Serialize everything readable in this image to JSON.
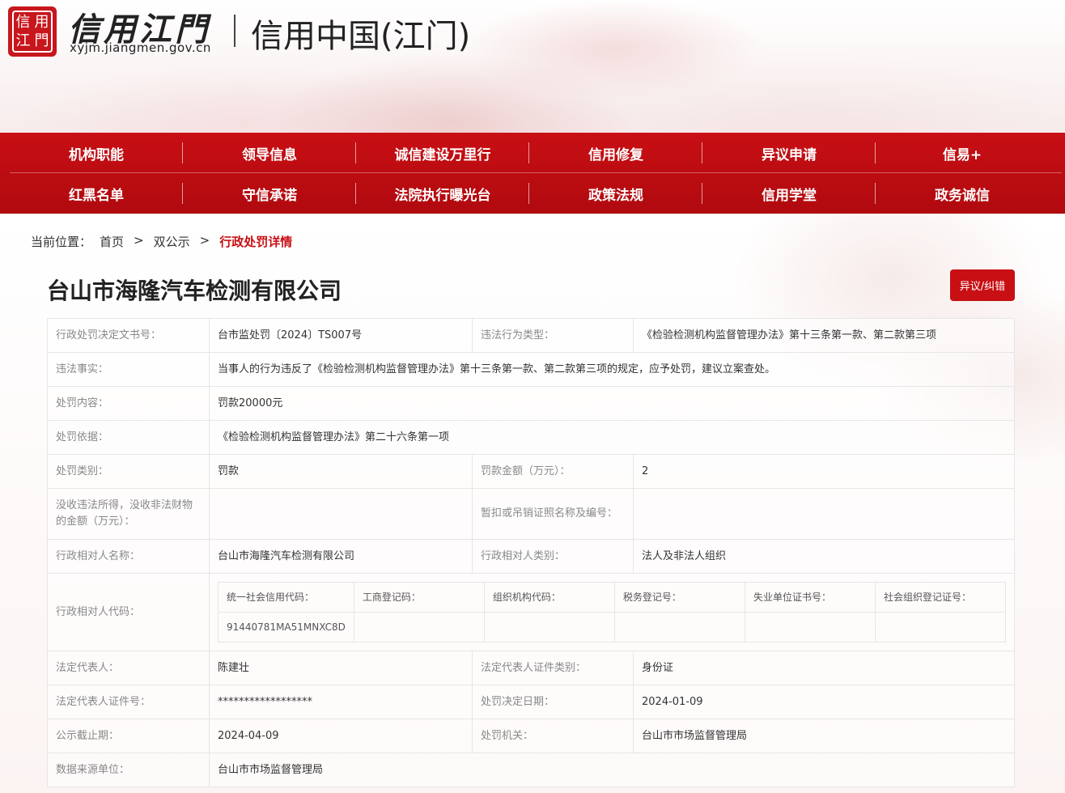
{
  "header": {
    "seal_text": "信用江門",
    "logo_title": "信用江門",
    "logo_domain": "xyjm.jiangmen.gov.cn",
    "site_name": "信用中国(江门)"
  },
  "nav": {
    "row1": [
      "机构职能",
      "领导信息",
      "诚信建设万里行",
      "信用修复",
      "异议申请",
      "信易+"
    ],
    "row2": [
      "红黑名单",
      "守信承诺",
      "法院执行曝光台",
      "政策法规",
      "信用学堂",
      "政务诚信"
    ]
  },
  "breadcrumb": {
    "label": "当前位置：",
    "home": "首页",
    "sep": ">",
    "section": "双公示",
    "current": "行政处罚详情"
  },
  "page": {
    "company_title": "台山市海隆汽车检测有限公司",
    "objection_button": "异议/纠错"
  },
  "details": {
    "decision_no_label": "行政处罚决定文书号：",
    "decision_no": "台市监处罚〔2024〕TS007号",
    "violation_type_label": "违法行为类型：",
    "violation_type": "《检验检测机构监督管理办法》第十三条第一款、第二款第三项",
    "facts_label": "违法事实：",
    "facts": "当事人的行为违反了《检验检测机构监督管理办法》第十三条第一款、第二款第三项的规定，应予处罚，建议立案查处。",
    "content_label": "处罚内容：",
    "content": "罚款20000元",
    "basis_label": "处罚依据：",
    "basis": "《检验检测机构监督管理办法》第二十六条第一项",
    "category_label": "处罚类别：",
    "category": "罚款",
    "amount_label": "罚款金额（万元）：",
    "amount": "2",
    "confiscation_label": "没收违法所得，没收非法财物的金额（万元）：",
    "confiscation": "",
    "license_label": "暂扣或吊销证照名称及编号：",
    "license": "",
    "party_name_label": "行政相对人名称：",
    "party_name": "台山市海隆汽车检测有限公司",
    "party_type_label": "行政相对人类别：",
    "party_type": "法人及非法人组织",
    "party_code_label": "行政相对人代码：",
    "codes": {
      "headers": [
        "统一社会信用代码：",
        "工商登记码：",
        "组织机构代码：",
        "税务登记号：",
        "失业单位证书号：",
        "社会组织登记证号："
      ],
      "values": [
        "91440781MA51MNXC8D",
        "",
        "",
        "",
        "",
        ""
      ]
    },
    "legal_rep_label": "法定代表人：",
    "legal_rep": "陈建壮",
    "legal_rep_id_type_label": "法定代表人证件类别：",
    "legal_rep_id_type": "身份证",
    "legal_rep_id_no_label": "法定代表人证件号：",
    "legal_rep_id_no": "******************",
    "decision_date_label": "处罚决定日期：",
    "decision_date": "2024-01-09",
    "publicity_deadline_label": "公示截止期：",
    "publicity_deadline": "2024-04-09",
    "authority_label": "处罚机关：",
    "authority": "台山市市场监督管理局",
    "data_source_label": "数据来源单位：",
    "data_source": "台山市市场监督管理局"
  }
}
